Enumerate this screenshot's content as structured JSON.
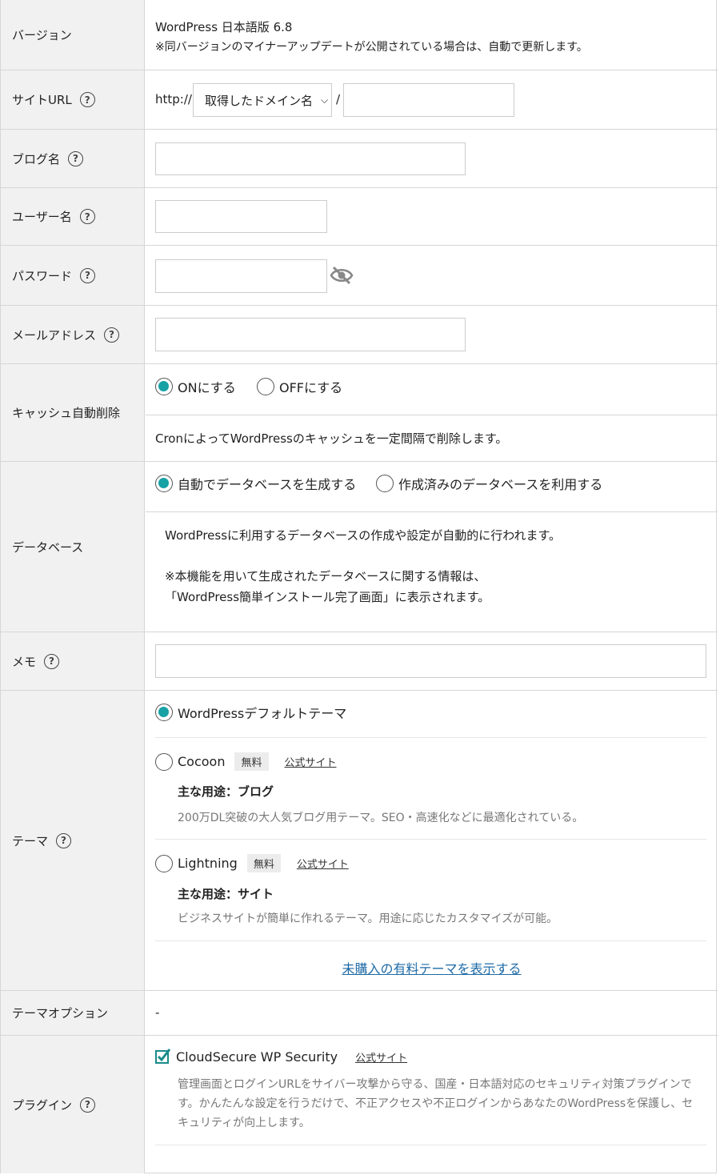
{
  "version": {
    "label": "バージョン",
    "line1": "WordPress 日本語版 6.8",
    "line2": "※同バージョンのマイナーアップデートが公開されている場合は、自動で更新します。"
  },
  "site_url": {
    "label": "サイトURL",
    "prefix": "http://",
    "domain_select": "取得したドメイン名",
    "slash": "/",
    "path_value": ""
  },
  "blog_name": {
    "label": "ブログ名",
    "value": ""
  },
  "username": {
    "label": "ユーザー名",
    "value": ""
  },
  "password": {
    "label": "パスワード",
    "value": ""
  },
  "email": {
    "label": "メールアドレス",
    "value": ""
  },
  "cache": {
    "label": "キャッシュ自動削除",
    "on_label": "ONにする",
    "off_label": "OFFにする",
    "selected": "on",
    "description": "CronによってWordPressのキャッシュを一定間隔で削除します。"
  },
  "database": {
    "label": "データベース",
    "auto_label": "自動でデータベースを生成する",
    "existing_label": "作成済みのデータベースを利用する",
    "selected": "auto",
    "desc1": "WordPressに利用するデータベースの作成や設定が自動的に行われます。",
    "desc2": "※本機能を用いて生成されたデータベースに関する情報は、",
    "desc3": "「WordPress簡単インストール完了画面」に表示されます。"
  },
  "memo": {
    "label": "メモ",
    "value": ""
  },
  "theme": {
    "label": "テーマ",
    "default_label": "WordPressデフォルトテーマ",
    "selected": "default",
    "cocoon": {
      "name": "Cocoon",
      "badge": "無料",
      "link": "公式サイト",
      "use": "主な用途：ブログ",
      "desc": "200万DL突破の大人気ブログ用テーマ。SEO・高速化などに最適化されている。"
    },
    "lightning": {
      "name": "Lightning",
      "badge": "無料",
      "link": "公式サイト",
      "use": "主な用途：サイト",
      "desc": "ビジネスサイトが簡単に作れるテーマ。用途に応じたカスタマイズが可能。"
    },
    "paid_link": "未購入の有料テーマを表示する"
  },
  "theme_option": {
    "label": "テーマオプション",
    "value": "-"
  },
  "plugin": {
    "label": "プラグイン",
    "name": "CloudSecure WP Security",
    "link": "公式サイト",
    "checked": true,
    "desc1": "管理画面とログインURLをサイバー攻撃から守る、国産・日本語対応のセキュリティ対策プラグインで",
    "desc2": "す。かんたんな設定を行うだけで、不正アクセスや不正ログインからあなたのWordPressを保護し、セ",
    "desc3": "キュリティが向上します。"
  },
  "colors": {
    "accent": "#17a1a5",
    "link": "#1e6aa6",
    "label_bg": "#f1f1f1",
    "checkbox": "#1a8a8a"
  }
}
